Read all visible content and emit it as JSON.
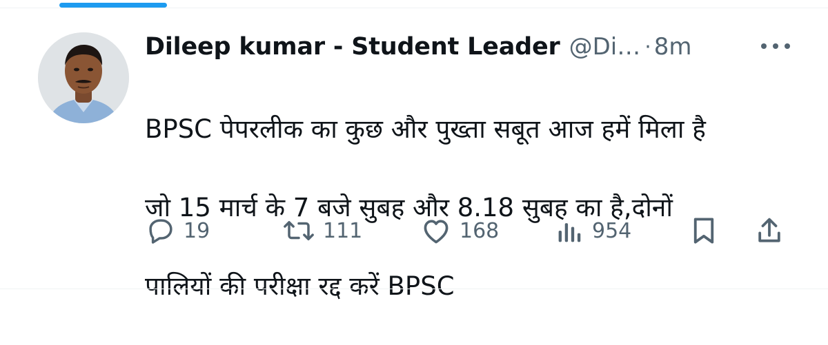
{
  "author": {
    "display_name": "Dileep kumar - Student Leader",
    "handle": "@Di…",
    "separator": "·",
    "time": "8m"
  },
  "tweet": {
    "lines": [
      "BPSC पेपरलीक का कुछ और पुख्ता सबूत आज हमें मिला है",
      "जो 15 मार्च के 7 बजे सुबह और 8.18 सुबह का है,दोनों",
      "पालियों की परीक्षा रद्द करें BPSC"
    ]
  },
  "actions": {
    "replies": "19",
    "reposts": "111",
    "likes": "168",
    "views": "954"
  },
  "icons": {
    "more": "more-horizontal-icon",
    "reply": "reply-icon",
    "repost": "repost-icon",
    "like": "heart-icon",
    "views": "views-bar-chart-icon",
    "bookmark": "bookmark-icon",
    "share": "share-icon"
  },
  "colors": {
    "accent": "#1d9bf0",
    "text_primary": "#0f1419",
    "text_secondary": "#536471",
    "divider": "#eff3f4"
  }
}
